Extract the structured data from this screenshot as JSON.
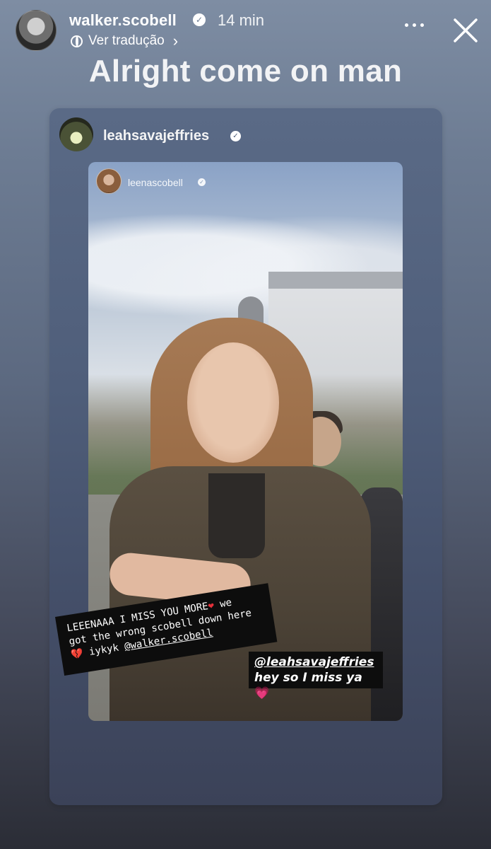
{
  "header": {
    "username": "walker.scobell",
    "timestamp": "14 min",
    "translate_label": "Ver tradução",
    "avatar_icon": "profile-avatar",
    "verified_icon": "verified-badge-icon",
    "more_icon": "more-horizontal-icon",
    "close_icon": "close-icon"
  },
  "story": {
    "caption": "Alright come on man"
  },
  "shared_post": {
    "username": "leahsavajeffries",
    "inner_story": {
      "username": "leenascobell"
    },
    "sticker_left": {
      "line1": "LEEENAAA I MISS YOU MORE",
      "heart": "❤",
      "line1_tail": " we",
      "line2": "got the wrong scobell down here",
      "broken_heart": "💔",
      "line3_text": " iykyk ",
      "mention": "@walker.scobell"
    },
    "sticker_right": {
      "mention": "@leahsavajeffries",
      "text": "hey so I miss ya",
      "heart": "💗"
    }
  },
  "colors": {
    "background_top": "#7e8da3",
    "background_bottom": "#2b2d36",
    "card": "#4f5e7a"
  }
}
